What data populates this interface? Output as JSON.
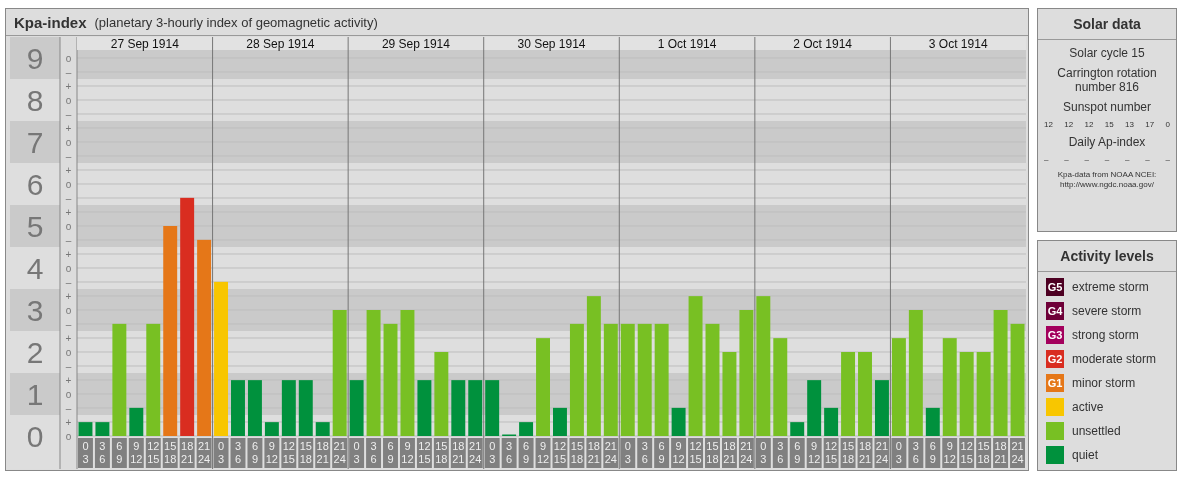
{
  "title": {
    "name": "Kpa-index",
    "subtitle": "(planetary 3-hourly index of geomagnetic activity)"
  },
  "chart": {
    "days": [
      "27 Sep 1914",
      "28 Sep 1914",
      "29 Sep 1914",
      "30 Sep 1914",
      "1 Oct 1914",
      "2 Oct 1914",
      "3 Oct 1914"
    ],
    "minor_labels": [
      "o",
      "–",
      "+",
      "o",
      "–",
      "+",
      "o",
      "–",
      "+",
      "o",
      "–",
      "+",
      "o",
      "–",
      "+",
      "o",
      "–",
      "+",
      "o",
      "–",
      "+",
      "o",
      "–",
      "+",
      "o",
      "–",
      "+",
      "o"
    ],
    "chart_data": {
      "type": "bar",
      "grid": true,
      "ylim": [
        0,
        9.5
      ],
      "yticks": [
        {
          "value": 0,
          "label": "0"
        },
        {
          "value": 1,
          "label": "1"
        },
        {
          "value": 2,
          "label": "2"
        },
        {
          "value": 3,
          "label": "3"
        },
        {
          "value": 4,
          "label": "4"
        },
        {
          "value": 5,
          "label": "5"
        },
        {
          "value": 6,
          "label": "6"
        },
        {
          "value": 7,
          "label": "7"
        },
        {
          "value": 8,
          "label": "8"
        },
        {
          "value": 9,
          "label": "9"
        }
      ],
      "categories": [
        "0 3",
        "3 6",
        "6 9",
        "9 12",
        "12 15",
        "15 18",
        "18 21",
        "21 24",
        "0 3",
        "3 6",
        "6 9",
        "9 12",
        "12 15",
        "15 18",
        "18 21",
        "21 24",
        "0 3",
        "3 6",
        "6 9",
        "9 12",
        "12 15",
        "15 18",
        "18 21",
        "21 24",
        "0 3",
        "3 6",
        "6 9",
        "9 12",
        "12 15",
        "15 18",
        "18 21",
        "21 24",
        "0 3",
        "3 6",
        "6 9",
        "9 12",
        "12 15",
        "15 18",
        "18 21",
        "21 24",
        "0 3",
        "3 6",
        "6 9",
        "9 12",
        "12 15",
        "15 18",
        "18 21",
        "21 24",
        "0 3",
        "3 6",
        "6 9",
        "9 12",
        "12 15",
        "15 18",
        "18 21",
        "21 24"
      ],
      "series": [
        {
          "color": "#00913d",
          "values": [
            0.33,
            0.33,
            null,
            0.67,
            null,
            null,
            null,
            null,
            null,
            1.33,
            1.33,
            0.33,
            1.33,
            1.33,
            0.33,
            null,
            1.33,
            null,
            null,
            null,
            1.33,
            null,
            1.33,
            1.33,
            1.33,
            0,
            0.33,
            null,
            0.67,
            null,
            null,
            null,
            null,
            null,
            null,
            0.67,
            null,
            null,
            null,
            null,
            null,
            null,
            0.33,
            1.33,
            0.67,
            null,
            null,
            1.33,
            null,
            null,
            0.67,
            null,
            null,
            null,
            null,
            null
          ]
        },
        {
          "color": "#78c023",
          "values": [
            null,
            null,
            2.67,
            null,
            2.67,
            null,
            null,
            null,
            null,
            null,
            null,
            null,
            null,
            null,
            null,
            3,
            null,
            3,
            2.67,
            3,
            null,
            2,
            null,
            null,
            null,
            null,
            null,
            2.33,
            null,
            2.67,
            3.33,
            2.67,
            2.67,
            2.67,
            2.67,
            null,
            3.33,
            2.67,
            2,
            3,
            3.33,
            2.33,
            null,
            null,
            null,
            2,
            2,
            null,
            2.33,
            3,
            null,
            2.33,
            2,
            2,
            3,
            2.67
          ]
        },
        {
          "color": "#f8c600",
          "values": [
            null,
            null,
            null,
            null,
            null,
            null,
            null,
            null,
            3.67,
            null,
            null,
            null,
            null,
            null,
            null,
            null,
            null,
            null,
            null,
            null,
            null,
            null,
            null,
            null,
            null,
            null,
            null,
            null,
            null,
            null,
            null,
            null,
            null,
            null,
            null,
            null,
            null,
            null,
            null,
            null,
            null,
            null,
            null,
            null,
            null,
            null,
            null,
            null,
            null,
            null,
            null,
            null,
            null,
            null,
            null,
            null
          ]
        },
        {
          "color": "#e57718",
          "values": [
            null,
            null,
            null,
            null,
            null,
            5,
            null,
            4.67,
            null,
            null,
            null,
            null,
            null,
            null,
            null,
            null,
            null,
            null,
            null,
            null,
            null,
            null,
            null,
            null,
            null,
            null,
            null,
            null,
            null,
            null,
            null,
            null,
            null,
            null,
            null,
            null,
            null,
            null,
            null,
            null,
            null,
            null,
            null,
            null,
            null,
            null,
            null,
            null,
            null,
            null,
            null,
            null,
            null,
            null,
            null,
            null
          ]
        },
        {
          "color": "#d92d20",
          "values": [
            null,
            null,
            null,
            null,
            null,
            null,
            5.67,
            null,
            null,
            null,
            null,
            null,
            null,
            null,
            null,
            null,
            null,
            null,
            null,
            null,
            null,
            null,
            null,
            null,
            null,
            null,
            null,
            null,
            null,
            null,
            null,
            null,
            null,
            null,
            null,
            null,
            null,
            null,
            null,
            null,
            null,
            null,
            null,
            null,
            null,
            null,
            null,
            null,
            null,
            null,
            null,
            null,
            null,
            null,
            null,
            null
          ]
        }
      ]
    }
  },
  "solar_data": {
    "title": "Solar data",
    "solar_cycle": "Solar cycle 15",
    "carrington": "Carrington rotation number 816",
    "sunspot_title": "Sunspot number",
    "sunspot_numbers": [
      "12",
      "12",
      "12",
      "15",
      "13",
      "17",
      "0"
    ],
    "ap_title": "Daily Ap-index",
    "ap_values": [
      "–",
      "–",
      "–",
      "–",
      "–",
      "–",
      "–"
    ],
    "source": "Kpa-data from NOAA NCEI:",
    "source_url": "http://www.ngdc.noaa.gov/"
  },
  "activity_levels": {
    "title": "Activity levels",
    "items": [
      {
        "badge": "G5",
        "label": "extreme storm",
        "color": "#4d0022"
      },
      {
        "badge": "G4",
        "label": "severe storm",
        "color": "#6e0038"
      },
      {
        "badge": "G3",
        "label": "strong storm",
        "color": "#a3005c"
      },
      {
        "badge": "G2",
        "label": "moderate storm",
        "color": "#d92d20"
      },
      {
        "badge": "G1",
        "label": "minor storm",
        "color": "#e57718"
      },
      {
        "label": "active",
        "color": "#f8c600"
      },
      {
        "label": "unsettled",
        "color": "#78c023"
      },
      {
        "label": "quiet",
        "color": "#00913d"
      }
    ]
  }
}
